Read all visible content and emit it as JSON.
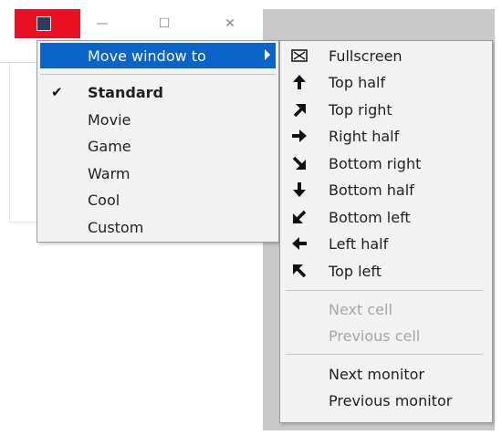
{
  "background_window": {
    "controls": [
      "—",
      "☐",
      "✕"
    ]
  },
  "main_menu": {
    "items": [
      {
        "label": "Move window to",
        "highlighted": true,
        "has_submenu": true
      },
      {
        "label": "Standard",
        "checked": true,
        "bold": true
      },
      {
        "label": "Movie"
      },
      {
        "label": "Game"
      },
      {
        "label": "Warm"
      },
      {
        "label": "Cool"
      },
      {
        "label": "Custom"
      }
    ]
  },
  "submenu": {
    "items": [
      {
        "label": "Fullscreen",
        "icon": "fullscreen-icon"
      },
      {
        "label": "Top half",
        "icon": "arrow-up-icon"
      },
      {
        "label": "Top right",
        "icon": "arrow-up-right-icon"
      },
      {
        "label": "Right half",
        "icon": "arrow-right-icon"
      },
      {
        "label": "Bottom right",
        "icon": "arrow-down-right-icon"
      },
      {
        "label": "Bottom half",
        "icon": "arrow-down-icon"
      },
      {
        "label": "Bottom left",
        "icon": "arrow-down-left-icon"
      },
      {
        "label": "Left half",
        "icon": "arrow-left-icon"
      },
      {
        "label": "Top left",
        "icon": "arrow-up-left-icon"
      },
      {
        "label": "Next cell",
        "disabled": true
      },
      {
        "label": "Previous cell",
        "disabled": true
      },
      {
        "label": "Next monitor"
      },
      {
        "label": "Previous monitor"
      }
    ]
  },
  "colors": {
    "highlight": "#0a63c9",
    "close_button": "#e81123",
    "menu_bg": "#f2f2f2",
    "disabled_text": "#a6a6a6"
  }
}
